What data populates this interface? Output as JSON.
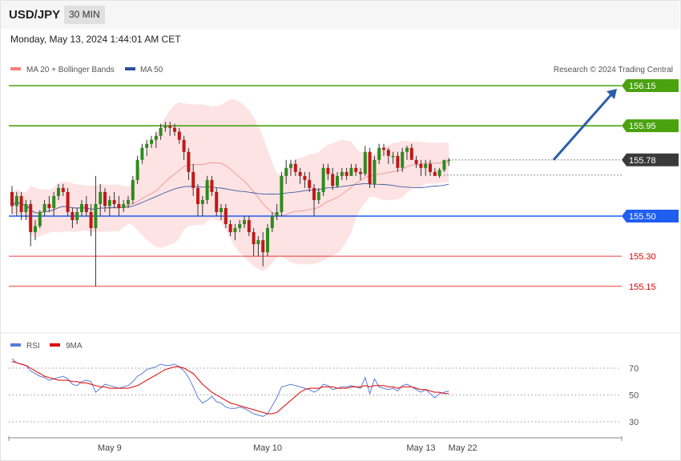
{
  "header": {
    "pair": "USD/JPY",
    "timeframe": "30 MIN"
  },
  "timestamp": "Monday, May 13, 2024 1:44:01 AM CET",
  "legend": {
    "ma20_label": "MA 20 + Bollinger Bands",
    "ma50_label": "MA 50",
    "copyright": "Research © 2024 Trading Central",
    "ma20_color": "#f08080",
    "ma50_color": "#2c4f9c"
  },
  "rsi_legend": {
    "rsi_label": "RSI",
    "ma_label": "9MA",
    "rsi_color": "#5b7bd8",
    "ma_color": "#e00000"
  },
  "chart_data": {
    "type": "candlestick",
    "price_range": [
      155.05,
      156.2
    ],
    "levels": [
      {
        "value": 156.15,
        "label": "156.15",
        "kind": "target",
        "color": "#4aa20e",
        "badge": true
      },
      {
        "value": 155.95,
        "label": "155.95",
        "kind": "resistance",
        "color": "#4aa20e",
        "badge": true
      },
      {
        "value": 155.78,
        "label": "155.78",
        "kind": "current",
        "color": "#3a3a3a",
        "badge": true
      },
      {
        "value": 155.5,
        "label": "155.50",
        "kind": "pivot",
        "color": "#1e5ef0",
        "badge": true
      },
      {
        "value": 155.3,
        "label": "155.30",
        "kind": "support",
        "color": "#e00000",
        "badge": false
      },
      {
        "value": 155.15,
        "label": "155.15",
        "kind": "support",
        "color": "#e00000",
        "badge": false
      }
    ],
    "candles": [
      [
        155.62,
        155.65,
        155.51,
        155.55
      ],
      [
        155.55,
        155.62,
        155.5,
        155.6
      ],
      [
        155.6,
        155.62,
        155.48,
        155.52
      ],
      [
        155.52,
        155.58,
        155.48,
        155.56
      ],
      [
        155.56,
        155.58,
        155.35,
        155.42
      ],
      [
        155.42,
        155.48,
        155.38,
        155.45
      ],
      [
        155.45,
        155.53,
        155.44,
        155.52
      ],
      [
        155.52,
        155.58,
        155.5,
        155.56
      ],
      [
        155.56,
        155.6,
        155.52,
        155.54
      ],
      [
        155.54,
        155.62,
        155.5,
        155.6
      ],
      [
        155.6,
        155.66,
        155.58,
        155.64
      ],
      [
        155.64,
        155.66,
        155.6,
        155.62
      ],
      [
        155.62,
        155.64,
        155.5,
        155.52
      ],
      [
        155.52,
        155.54,
        155.44,
        155.48
      ],
      [
        155.48,
        155.54,
        155.46,
        155.52
      ],
      [
        155.52,
        155.58,
        155.5,
        155.56
      ],
      [
        155.56,
        155.6,
        155.5,
        155.52
      ],
      [
        155.52,
        155.56,
        155.4,
        155.44
      ],
      [
        155.44,
        155.7,
        155.15,
        155.56
      ],
      [
        155.56,
        155.66,
        155.5,
        155.62
      ],
      [
        155.62,
        155.64,
        155.52,
        155.55
      ],
      [
        155.55,
        155.6,
        155.5,
        155.58
      ],
      [
        155.58,
        155.62,
        155.54,
        155.56
      ],
      [
        155.56,
        155.6,
        155.5,
        155.54
      ],
      [
        155.54,
        155.58,
        155.52,
        155.56
      ],
      [
        155.56,
        155.6,
        155.54,
        155.58
      ],
      [
        155.58,
        155.7,
        155.56,
        155.68
      ],
      [
        155.68,
        155.8,
        155.66,
        155.78
      ],
      [
        155.78,
        155.86,
        155.76,
        155.84
      ],
      [
        155.84,
        155.88,
        155.8,
        155.86
      ],
      [
        155.86,
        155.9,
        155.84,
        155.88
      ],
      [
        155.88,
        155.92,
        155.84,
        155.9
      ],
      [
        155.9,
        155.96,
        155.88,
        155.94
      ],
      [
        155.94,
        155.97,
        155.92,
        155.95
      ],
      [
        155.95,
        155.97,
        155.9,
        155.94
      ],
      [
        155.94,
        155.96,
        155.9,
        155.92
      ],
      [
        155.92,
        155.94,
        155.86,
        155.88
      ],
      [
        155.88,
        155.9,
        155.78,
        155.82
      ],
      [
        155.82,
        155.84,
        155.68,
        155.72
      ],
      [
        155.72,
        155.76,
        155.6,
        155.64
      ],
      [
        155.64,
        155.66,
        155.5,
        155.56
      ],
      [
        155.56,
        155.6,
        155.5,
        155.58
      ],
      [
        155.58,
        155.7,
        155.56,
        155.68
      ],
      [
        155.68,
        155.7,
        155.6,
        155.62
      ],
      [
        155.62,
        155.64,
        155.5,
        155.52
      ],
      [
        155.52,
        155.56,
        155.48,
        155.54
      ],
      [
        155.54,
        155.56,
        155.44,
        155.46
      ],
      [
        155.46,
        155.48,
        155.4,
        155.42
      ],
      [
        155.42,
        155.46,
        155.38,
        155.44
      ],
      [
        155.44,
        155.48,
        155.42,
        155.46
      ],
      [
        155.46,
        155.5,
        155.44,
        155.48
      ],
      [
        155.48,
        155.5,
        155.4,
        155.42
      ],
      [
        155.42,
        155.44,
        155.3,
        155.36
      ],
      [
        155.36,
        155.4,
        155.3,
        155.38
      ],
      [
        155.38,
        155.42,
        155.25,
        155.32
      ],
      [
        155.32,
        155.46,
        155.3,
        155.44
      ],
      [
        155.44,
        155.52,
        155.42,
        155.5
      ],
      [
        155.5,
        155.56,
        155.48,
        155.52
      ],
      [
        155.52,
        155.72,
        155.5,
        155.7
      ],
      [
        155.7,
        155.78,
        155.66,
        155.74
      ],
      [
        155.74,
        155.78,
        155.7,
        155.76
      ],
      [
        155.76,
        155.78,
        155.7,
        155.72
      ],
      [
        155.72,
        155.74,
        155.66,
        155.7
      ],
      [
        155.7,
        155.72,
        155.64,
        155.68
      ],
      [
        155.68,
        155.72,
        155.62,
        155.64
      ],
      [
        155.64,
        155.66,
        155.5,
        155.58
      ],
      [
        155.58,
        155.64,
        155.56,
        155.62
      ],
      [
        155.62,
        155.76,
        155.6,
        155.74
      ],
      [
        155.74,
        155.76,
        155.68,
        155.71
      ],
      [
        155.71,
        155.74,
        155.63,
        155.65
      ],
      [
        155.65,
        155.72,
        155.64,
        155.7
      ],
      [
        155.7,
        155.74,
        155.68,
        155.72
      ],
      [
        155.72,
        155.74,
        155.68,
        155.7
      ],
      [
        155.7,
        155.76,
        155.7,
        155.74
      ],
      [
        155.74,
        155.76,
        155.7,
        155.72
      ],
      [
        155.72,
        155.74,
        155.68,
        155.71
      ],
      [
        155.71,
        155.85,
        155.7,
        155.82
      ],
      [
        155.82,
        155.84,
        155.64,
        155.66
      ],
      [
        155.66,
        155.8,
        155.64,
        155.78
      ],
      [
        155.78,
        155.86,
        155.76,
        155.84
      ],
      [
        155.84,
        155.86,
        155.8,
        155.83
      ],
      [
        155.83,
        155.84,
        155.76,
        155.8
      ],
      [
        155.8,
        155.82,
        155.76,
        155.8
      ],
      [
        155.8,
        155.82,
        155.72,
        155.74
      ],
      [
        155.74,
        155.84,
        155.72,
        155.82
      ],
      [
        155.82,
        155.85,
        155.78,
        155.84
      ],
      [
        155.84,
        155.86,
        155.8,
        155.78
      ],
      [
        155.78,
        155.8,
        155.74,
        155.76
      ],
      [
        155.76,
        155.78,
        155.7,
        155.74
      ],
      [
        155.74,
        155.78,
        155.7,
        155.76
      ],
      [
        155.76,
        155.78,
        155.7,
        155.72
      ],
      [
        155.72,
        155.74,
        155.7,
        155.7
      ],
      [
        155.7,
        155.74,
        155.69,
        155.73
      ],
      [
        155.73,
        155.78,
        155.72,
        155.78
      ],
      [
        155.78,
        155.79,
        155.75,
        155.78
      ]
    ],
    "rsi": [
      77,
      74,
      73,
      72,
      68,
      66,
      64,
      63,
      61,
      62,
      63,
      64,
      62,
      58,
      57,
      60,
      61,
      60,
      52,
      55,
      58,
      57,
      56,
      55,
      56,
      57,
      60,
      64,
      66,
      69,
      70,
      71,
      73,
      72,
      72,
      73,
      71,
      68,
      63,
      56,
      48,
      44,
      46,
      49,
      45,
      44,
      41,
      40,
      40,
      41,
      40,
      38,
      36,
      35,
      34,
      36,
      42,
      48,
      56,
      57,
      58,
      57,
      56,
      55,
      54,
      52,
      54,
      58,
      57,
      54,
      55,
      56,
      56,
      57,
      56,
      55,
      63,
      51,
      62,
      56,
      55,
      54,
      55,
      53,
      57,
      58,
      56,
      54,
      52,
      54,
      51,
      48,
      51,
      52,
      53
    ],
    "rsi_ma": [
      75,
      74,
      73,
      72,
      70,
      68,
      66,
      64,
      63,
      62,
      61,
      61,
      61,
      60,
      60,
      59,
      59,
      58,
      57,
      56,
      56,
      55,
      55,
      55,
      55,
      55,
      56,
      57,
      59,
      61,
      63,
      65,
      67,
      69,
      70,
      71,
      71,
      70,
      68,
      66,
      62,
      58,
      55,
      52,
      50,
      48,
      46,
      44,
      43,
      42,
      41,
      40,
      39,
      38,
      37,
      36,
      36,
      37,
      40,
      43,
      46,
      49,
      52,
      54,
      55,
      55,
      55,
      56,
      56,
      56,
      55,
      55,
      55,
      56,
      56,
      56,
      57,
      56,
      57,
      57,
      57,
      56,
      56,
      55,
      56,
      56,
      56,
      55,
      54,
      54,
      53,
      52,
      52,
      51,
      51
    ],
    "rsi_range": [
      20,
      80
    ],
    "rsi_ticks": [
      70,
      50,
      30
    ],
    "x_labels": [
      "May 9",
      "May 10",
      "May 13",
      "May 22"
    ],
    "x_label_index": [
      21,
      55,
      88,
      97
    ]
  }
}
